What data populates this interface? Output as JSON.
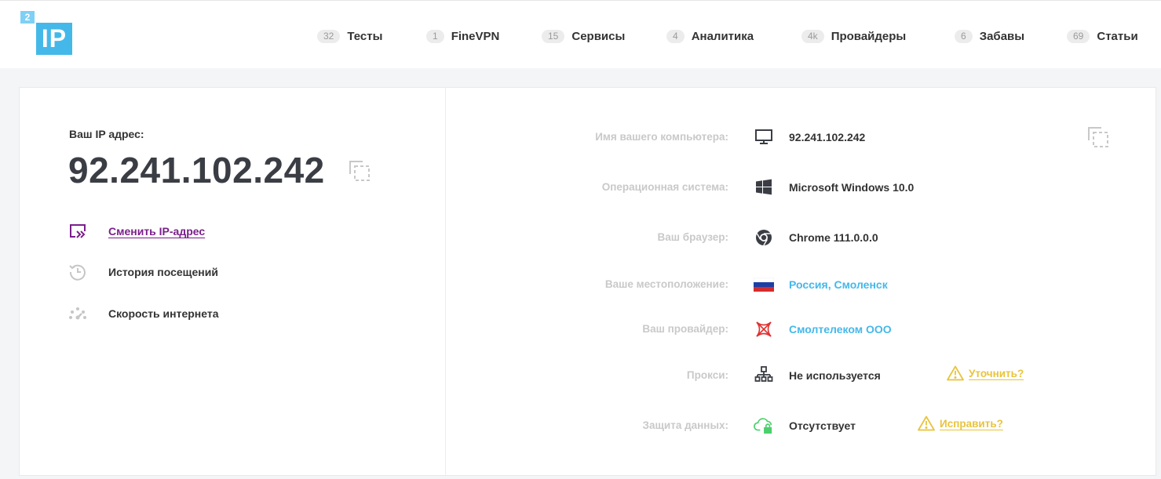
{
  "logo": {
    "small": "2",
    "big": "IP"
  },
  "nav": [
    {
      "count": "32",
      "label": "Тесты"
    },
    {
      "count": "1",
      "label": "FineVPN"
    },
    {
      "count": "15",
      "label": "Сервисы"
    },
    {
      "count": "4",
      "label": "Аналитика"
    },
    {
      "count": "4k",
      "label": "Провайдеры"
    },
    {
      "count": "6",
      "label": "Забавы"
    },
    {
      "count": "69",
      "label": "Статьи"
    }
  ],
  "ip": {
    "label": "Ваш IP адрес:",
    "value": "92.241.102.242"
  },
  "actions": {
    "change_ip": "Сменить IP-адрес",
    "history": "История посещений",
    "speed": "Скорость интернета"
  },
  "info": {
    "computer": {
      "key": "Имя вашего компьютера:",
      "value": "92.241.102.242",
      "icon": "monitor-icon"
    },
    "os": {
      "key": "Операционная система:",
      "value": "Microsoft Windows 10.0",
      "icon": "windows-icon"
    },
    "browser": {
      "key": "Ваш браузер:",
      "value": "Chrome 111.0.0.0",
      "icon": "chrome-icon"
    },
    "location": {
      "key": "Ваше местоположение:",
      "value": "Россия, Смоленск",
      "icon": "russia-flag-icon"
    },
    "provider": {
      "key": "Ваш провайдер:",
      "value": "Смолтелеком ООО",
      "icon": "provider-logo-icon"
    },
    "proxy": {
      "key": "Прокси:",
      "value": "Не используется",
      "icon": "network-icon",
      "warn_link": "Уточнить?"
    },
    "protection": {
      "key": "Защита данных:",
      "value": "Отсутствует",
      "icon": "cloud-lock-icon",
      "warn_link": "Исправить?"
    }
  },
  "colors": {
    "accent": "#45b8ea",
    "link_purple": "#7a1f8a",
    "warning": "#e8c43c",
    "label_gray": "#c9c9c9"
  }
}
